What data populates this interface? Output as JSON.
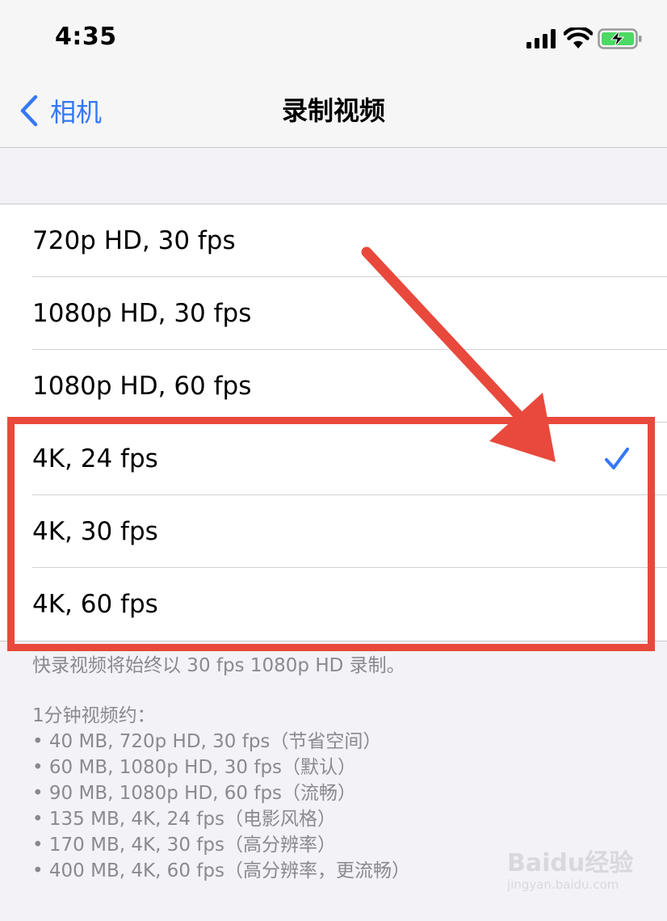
{
  "status_bar": {
    "time": "4:35"
  },
  "nav": {
    "back_label": "相机",
    "title": "录制视频"
  },
  "options": [
    {
      "label": "720p HD, 30 fps",
      "selected": false
    },
    {
      "label": "1080p HD, 30 fps",
      "selected": false
    },
    {
      "label": "1080p HD, 60 fps",
      "selected": false
    },
    {
      "label": "4K, 24 fps",
      "selected": true
    },
    {
      "label": "4K, 30 fps",
      "selected": false
    },
    {
      "label": "4K, 60 fps",
      "selected": false
    }
  ],
  "footer": {
    "note": "快录视频将始终以 30 fps 1080p HD 录制。",
    "intro": "1分钟视频约：",
    "items": [
      "40 MB, 720p HD, 30 fps（节省空间）",
      "60 MB, 1080p HD, 30 fps（默认）",
      "90 MB, 1080p HD, 60 fps（流畅）",
      "135 MB, 4K, 24 fps（电影风格）",
      "170 MB, 4K, 30 fps（高分辨率）",
      "400 MB, 4K, 60 fps（高分辨率，更流畅）"
    ]
  },
  "watermark": {
    "logo": "Baidu经验",
    "url": "jingyan.baidu.com"
  },
  "colors": {
    "accent": "#3478f6",
    "annotation": "#e8493c",
    "battery_fill": "#4cd964"
  },
  "icons": {
    "signal": "cellular-signal-icon",
    "wifi": "wifi-icon",
    "battery": "battery-charging-icon",
    "back": "chevron-left-icon",
    "selected": "checkmark-icon"
  }
}
